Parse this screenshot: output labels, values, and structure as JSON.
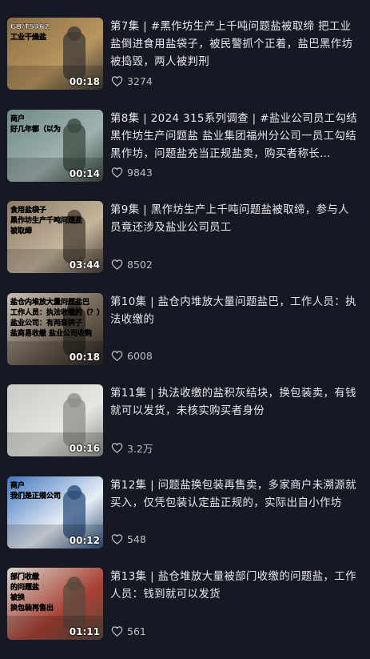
{
  "episodes": [
    {
      "title": "第7集 | #黑作坊生产上千吨问题盐被取缔 把工业盐倒进食用盐袋子，被民警抓个正着，盐巴黑作坊被捣毁，两人被判刑",
      "duration": "00:18",
      "likes": "3274",
      "thumb_text": [
        "GB/T5462",
        "工业干燥盐"
      ],
      "thumb_colors": [
        "#8a6b43",
        "#b9965f",
        "#3e3a36"
      ]
    },
    {
      "title": "第8集 | 2024 315系列调查 | #盐业公司员工勾结黑作坊生产问题盐 盐业集团福州分公司一员工勾结黑作坊，问题盐充当正规盐卖，购买者称长…",
      "duration": "00:14",
      "likes": "9843",
      "thumb_text": [
        "商户",
        "好几年都（以为"
      ],
      "thumb_colors": [
        "#6f8a86",
        "#9fb2b0",
        "#3b4a3f"
      ]
    },
    {
      "title": "第9集 | 黑作坊生产上千吨问题盐被取缔，参与人员竟还涉及盐业公司员工",
      "duration": "03:44",
      "likes": "8502",
      "thumb_text": [
        "食用盐袋子",
        "黑作坊生产千吨问题盐",
        "被取缔"
      ],
      "thumb_colors": [
        "#8d7a64",
        "#c4b49a",
        "#4a3f35"
      ]
    },
    {
      "title": "第10集 | 盐仓内堆放大量问题盐巴，工作人员：执法收缴的",
      "duration": "00:18",
      "likes": "6008",
      "thumb_text": [
        "盐仓内堆放大量问题盐巴",
        "工作人员：执法收缴的（？）",
        "盐业公司：有两套牌子",
        "盐商易收缴 盐业公司收购"
      ],
      "thumb_colors": [
        "#c8c0b4",
        "#6b5d4f",
        "#2a2520"
      ]
    },
    {
      "title": "第11集 | 执法收缴的盐积灰结块，换包装卖，有钱就可以发货，未核实购买者身份",
      "duration": "00:16",
      "likes": "3.2万",
      "thumb_text": [],
      "thumb_colors": [
        "#c9c9c6",
        "#e6e6e2",
        "#8f8f8a"
      ]
    },
    {
      "title": "第12集 | 问题盐换包装再售卖，多家商户未溯源就买入，仅凭包装认定盐正规的，实际出自小作坊",
      "duration": "00:12",
      "likes": "548",
      "thumb_text": [
        "商户",
        "我们是正规公司"
      ],
      "thumb_colors": [
        "#3f77c0",
        "#e9eef5",
        "#2c4f7d"
      ]
    },
    {
      "title": "第13集 | 盐仓堆放大量被部门收缴的问题盐，工作人员：钱到就可以发货",
      "duration": "01:11",
      "likes": "561",
      "thumb_text": [
        "部门收缴",
        "的问题盐",
        "被换",
        "换包装再售出"
      ],
      "thumb_colors": [
        "#d9d4cc",
        "#a94034",
        "#5a4a3c"
      ]
    }
  ],
  "icons": {
    "like": "heart-outline-icon"
  }
}
